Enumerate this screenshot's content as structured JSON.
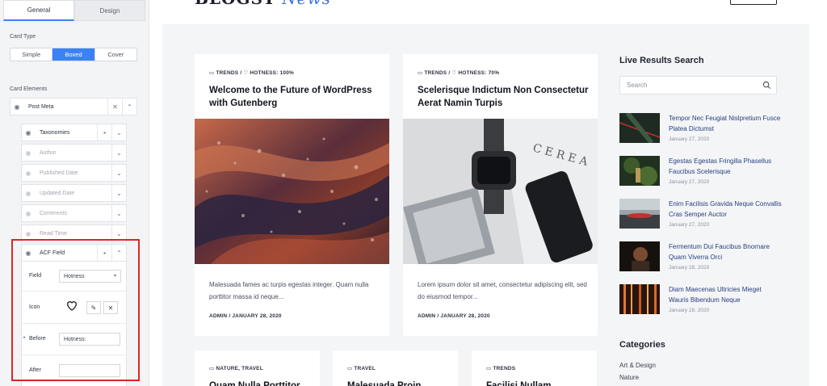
{
  "panel": {
    "tabs": [
      {
        "label": "General",
        "active": true
      },
      {
        "label": "Design",
        "active": false
      }
    ],
    "card_type_label": "Card Type",
    "card_types": [
      {
        "label": "Simple",
        "active": false
      },
      {
        "label": "Boxed",
        "active": true
      },
      {
        "label": "Cover",
        "active": false
      }
    ],
    "card_elements_label": "Card Elements",
    "post_meta_label": "Post Meta",
    "meta_items": [
      {
        "label": "Taxonomies",
        "enabled": true
      },
      {
        "label": "Author",
        "enabled": false
      },
      {
        "label": "Published Date",
        "enabled": false
      },
      {
        "label": "Updated Date",
        "enabled": false
      },
      {
        "label": "Comments",
        "enabled": false
      },
      {
        "label": "Read Time",
        "enabled": false
      }
    ],
    "acf": {
      "title": "ACF Field",
      "field_label": "Field",
      "field_value": "Hotness",
      "icon_label": "Icon",
      "before_label": "Before",
      "before_value": "Hotness:",
      "after_label": "After",
      "after_value": ""
    }
  },
  "site": {
    "logo_main": "BLOGSY",
    "logo_accent": "News"
  },
  "cards": [
    {
      "meta_tax": "TRENDS",
      "meta_sep": "/",
      "meta_extra": "HOTNESS: 100%",
      "title": "Welcome to the Future of WordPress with Gutenberg",
      "excerpt": "Malesuada fames ac turpis egestas integer. Quam nulla porttitor massa id neque...",
      "author": "ADMIN",
      "date": "JANUARY 28, 2020"
    },
    {
      "meta_tax": "TRENDS",
      "meta_sep": "/",
      "meta_extra": "HOTNESS: 70%",
      "title": "Scelerisque Indictum Non Consectetur Aerat Namin Turpis",
      "excerpt": "Lorem ipsum dolor sit amet, consectetur adipiscing elit, sed do eiusmod tempor...",
      "author": "ADMIN",
      "date": "JANUARY 28, 2020"
    }
  ],
  "bottom_cards": [
    {
      "meta": "NATURE, TRAVEL",
      "title": "Quam Nulla Porttitor"
    },
    {
      "meta": "TRAVEL",
      "title": "Malesuada Proin"
    },
    {
      "meta": "TRENDS",
      "title": "Facilisi Nullam"
    }
  ],
  "sidebar": {
    "search_heading": "Live Results Search",
    "search_placeholder": "Search",
    "items": [
      {
        "title": "Tempor Nec Feugiat Nislpretium Fusce Platea Dictumst",
        "date": "January 27, 2020"
      },
      {
        "title": "Egestas Egestas Fringilla Phasellus Faucibus Scelerisque",
        "date": "January 27, 2020"
      },
      {
        "title": "Enim Facilisis Gravida Neque Convallis Cras Semper Auctor",
        "date": "January 27, 2020"
      },
      {
        "title": "Fermentum Dui Faucibus Bnornare Quam Viverra Orci",
        "date": "January 28, 2020"
      },
      {
        "title": "Diam Maecenas Ultricies Mieget Wauris Bibendum Neque",
        "date": "January 28, 2020"
      }
    ],
    "categories_heading": "Categories",
    "categories": [
      "Art & Design",
      "Nature"
    ]
  },
  "colors": {
    "accent": "#3b82f6",
    "highlight_box": "#e02424",
    "link": "#27407f"
  }
}
